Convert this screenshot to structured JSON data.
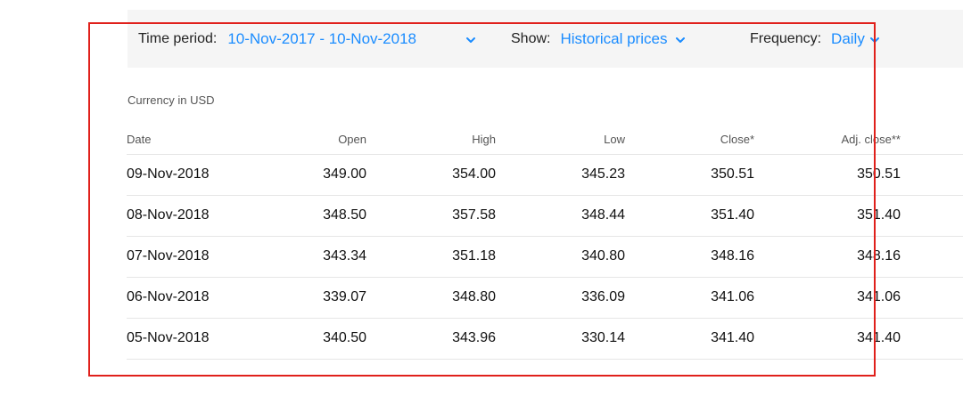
{
  "filters": {
    "time_period": {
      "label": "Time period:",
      "value": "10-Nov-2017 - 10-Nov-2018",
      "icon": "chevron-down-icon"
    },
    "show": {
      "label": "Show:",
      "value": "Historical prices",
      "icon": "chevron-down-icon"
    },
    "frequency": {
      "label": "Frequency:",
      "value": "Daily",
      "icon": "chevron-down-icon"
    }
  },
  "currency_note": "Currency in USD",
  "table": {
    "headers": {
      "date": "Date",
      "open": "Open",
      "high": "High",
      "low": "Low",
      "close": "Close*",
      "adj_close": "Adj. close**"
    },
    "rows": [
      {
        "date": "09-Nov-2018",
        "open": "349.00",
        "high": "354.00",
        "low": "345.23",
        "close": "350.51",
        "adj_close": "350.51"
      },
      {
        "date": "08-Nov-2018",
        "open": "348.50",
        "high": "357.58",
        "low": "348.44",
        "close": "351.40",
        "adj_close": "351.40"
      },
      {
        "date": "07-Nov-2018",
        "open": "343.34",
        "high": "351.18",
        "low": "340.80",
        "close": "348.16",
        "adj_close": "348.16"
      },
      {
        "date": "06-Nov-2018",
        "open": "339.07",
        "high": "348.80",
        "low": "336.09",
        "close": "341.06",
        "adj_close": "341.06"
      },
      {
        "date": "05-Nov-2018",
        "open": "340.50",
        "high": "343.96",
        "low": "330.14",
        "close": "341.40",
        "adj_close": "341.40"
      }
    ]
  },
  "colors": {
    "accent_blue": "#1a8cff",
    "highlight_red": "#e0201b",
    "filter_bar_bg": "#f5f5f5"
  }
}
